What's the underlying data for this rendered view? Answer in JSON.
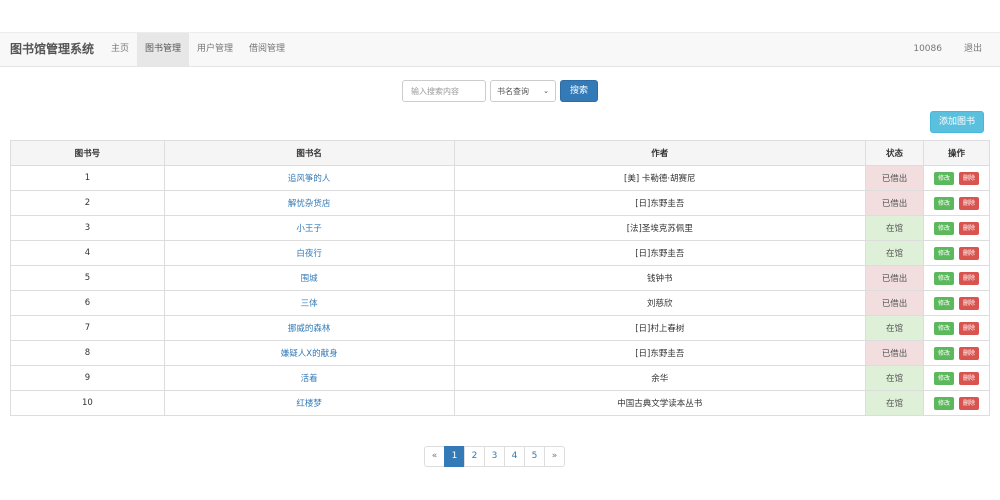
{
  "navbar": {
    "brand": "图书馆管理系统",
    "items": [
      {
        "label": "主页"
      },
      {
        "label": "图书管理"
      },
      {
        "label": "用户管理"
      },
      {
        "label": "借阅管理"
      }
    ],
    "user": "10086",
    "logout": "退出"
  },
  "search": {
    "placeholder": "输入搜索内容",
    "select_value": "书名查询",
    "button": "搜索"
  },
  "add_button": "添加图书",
  "table": {
    "headers": [
      "图书号",
      "图书名",
      "作者",
      "状态",
      "操作"
    ],
    "edit_label": "修改",
    "delete_label": "删除",
    "rows": [
      {
        "id": "1",
        "name": "追风筝的人",
        "author": "[美] 卡勒德·胡赛尼",
        "status": "已借出",
        "status_color": "#f2dede"
      },
      {
        "id": "2",
        "name": "解忧杂货店",
        "author": "[日]东野圭吾",
        "status": "已借出",
        "status_color": "#f2dede"
      },
      {
        "id": "3",
        "name": "小王子",
        "author": "[法]圣埃克苏佩里",
        "status": "在馆",
        "status_color": "#dff0d8"
      },
      {
        "id": "4",
        "name": "白夜行",
        "author": "[日]东野圭吾",
        "status": "在馆",
        "status_color": "#dff0d8"
      },
      {
        "id": "5",
        "name": "围城",
        "author": "钱钟书",
        "status": "已借出",
        "status_color": "#f2dede"
      },
      {
        "id": "6",
        "name": "三体",
        "author": "刘慈欣",
        "status": "已借出",
        "status_color": "#f2dede"
      },
      {
        "id": "7",
        "name": "挪威的森林",
        "author": "[日]村上春树",
        "status": "在馆",
        "status_color": "#dff0d8"
      },
      {
        "id": "8",
        "name": "嫌疑人X的献身",
        "author": "[日]东野圭吾",
        "status": "已借出",
        "status_color": "#f2dede"
      },
      {
        "id": "9",
        "name": "活着",
        "author": "余华",
        "status": "在馆",
        "status_color": "#dff0d8"
      },
      {
        "id": "10",
        "name": "红楼梦",
        "author": "中国古典文学读本丛书",
        "status": "在馆",
        "status_color": "#dff0d8"
      }
    ]
  },
  "pagination": {
    "prev": "«",
    "next": "»",
    "pages": [
      "1",
      "2",
      "3",
      "4",
      "5"
    ],
    "current": "1"
  },
  "colors": {
    "primary": "#337ab7",
    "info": "#5bc0de",
    "success": "#5cb85c",
    "danger": "#d9534f",
    "lent_bg": "#f2dede",
    "in_bg": "#dff0d8"
  }
}
